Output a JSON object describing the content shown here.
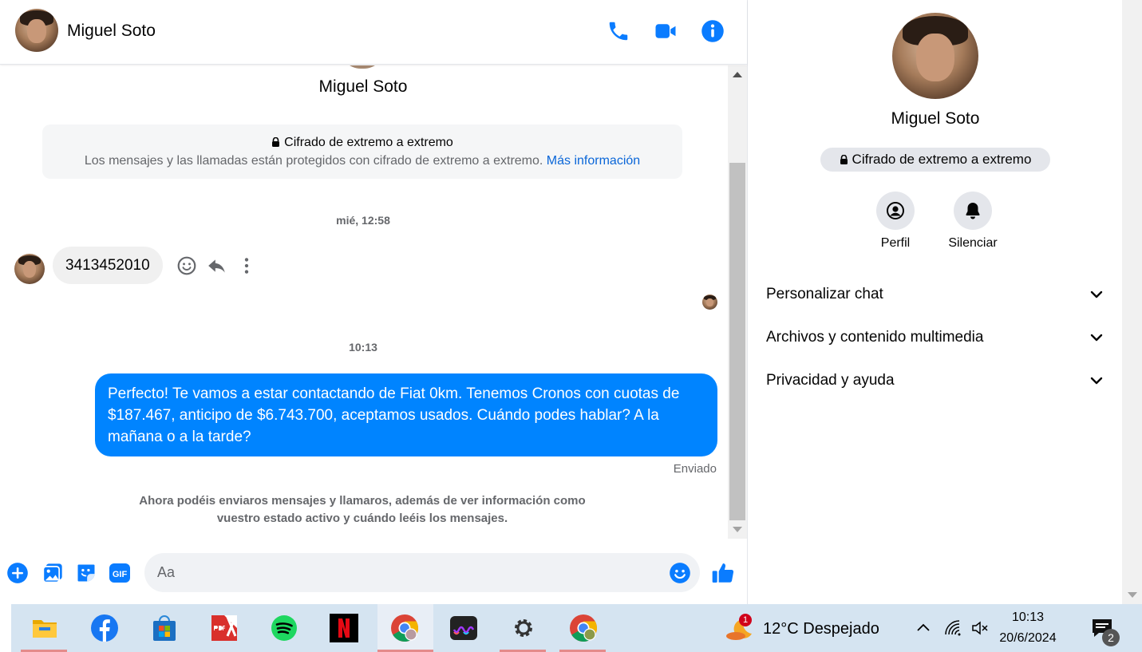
{
  "contact": {
    "name": "Miguel Soto"
  },
  "encryption": {
    "title": "Cifrado de extremo a extremo",
    "description": "Los mensajes y las llamadas están protegidos con cifrado de extremo a extremo.",
    "more_link": "Más información"
  },
  "messages": {
    "timestamp_1": "mié, 12:58",
    "received_text": "3413452010",
    "timestamp_2": "10:13",
    "sent_text": "Perfecto! Te vamos a estar contactando de Fiat 0km. Tenemos Cronos con cuotas de $187.467, anticipo de $6.743.700, aceptamos usados. Cuándo podes hablar? A la mañana o a la tarde?",
    "sent_status": "Enviado",
    "notice": "Ahora podéis enviaros mensajes y llamaros, además de ver información como vuestro estado activo y cuándo leéis los mensajes."
  },
  "composer": {
    "placeholder": "Aa",
    "gif_label": "GIF"
  },
  "panel": {
    "encryption_badge": "Cifrado de extremo a extremo",
    "profile_label": "Perfil",
    "mute_label": "Silenciar",
    "sections": [
      "Personalizar chat",
      "Archivos y contenido multimedia",
      "Privacidad y ayuda"
    ]
  },
  "taskbar": {
    "apps": [
      "file-explorer",
      "facebook",
      "microsoft-store",
      "pdf-viewer",
      "spotify",
      "netflix",
      "chrome",
      "deezer",
      "settings",
      "chrome-profile"
    ],
    "weather": {
      "temp_text": "12°C  Despejado",
      "badge": "1"
    },
    "clock": {
      "time": "10:13",
      "date": "20/6/2024"
    },
    "notifications_badge": "2"
  },
  "colors": {
    "messenger_blue": "#0084ff",
    "icon_blue": "#0a7cff",
    "taskbar": "#d5e4f1"
  }
}
